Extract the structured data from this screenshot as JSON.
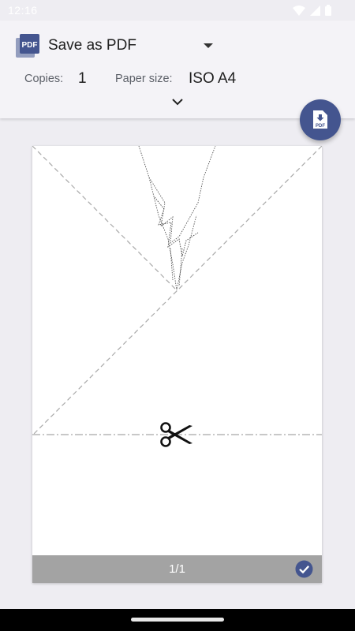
{
  "status_bar": {
    "time": "12:16",
    "icons": [
      "wifi-icon",
      "signal-icon",
      "battery-icon"
    ]
  },
  "header": {
    "printer_icon": "pdf-document-icon",
    "printer_icon_text": "PDF",
    "printer_name": "Save as PDF",
    "copies_label": "Copies:",
    "copies_value": "1",
    "paper_size_label": "Paper size:",
    "paper_size_value": "ISO A4",
    "expand_icon": "chevron-down-icon"
  },
  "fab": {
    "icon": "download-pdf-icon",
    "icon_text": "PDF",
    "accent": "#44558f"
  },
  "preview": {
    "page_indicator": "1/1",
    "selected_icon": "check-circle-icon",
    "footer_color": "#a3a3a3",
    "content_icon": "scissors-icon"
  },
  "colors": {
    "background": "#eeedf2",
    "header": "#f4f3f7",
    "accent": "#44558f"
  }
}
